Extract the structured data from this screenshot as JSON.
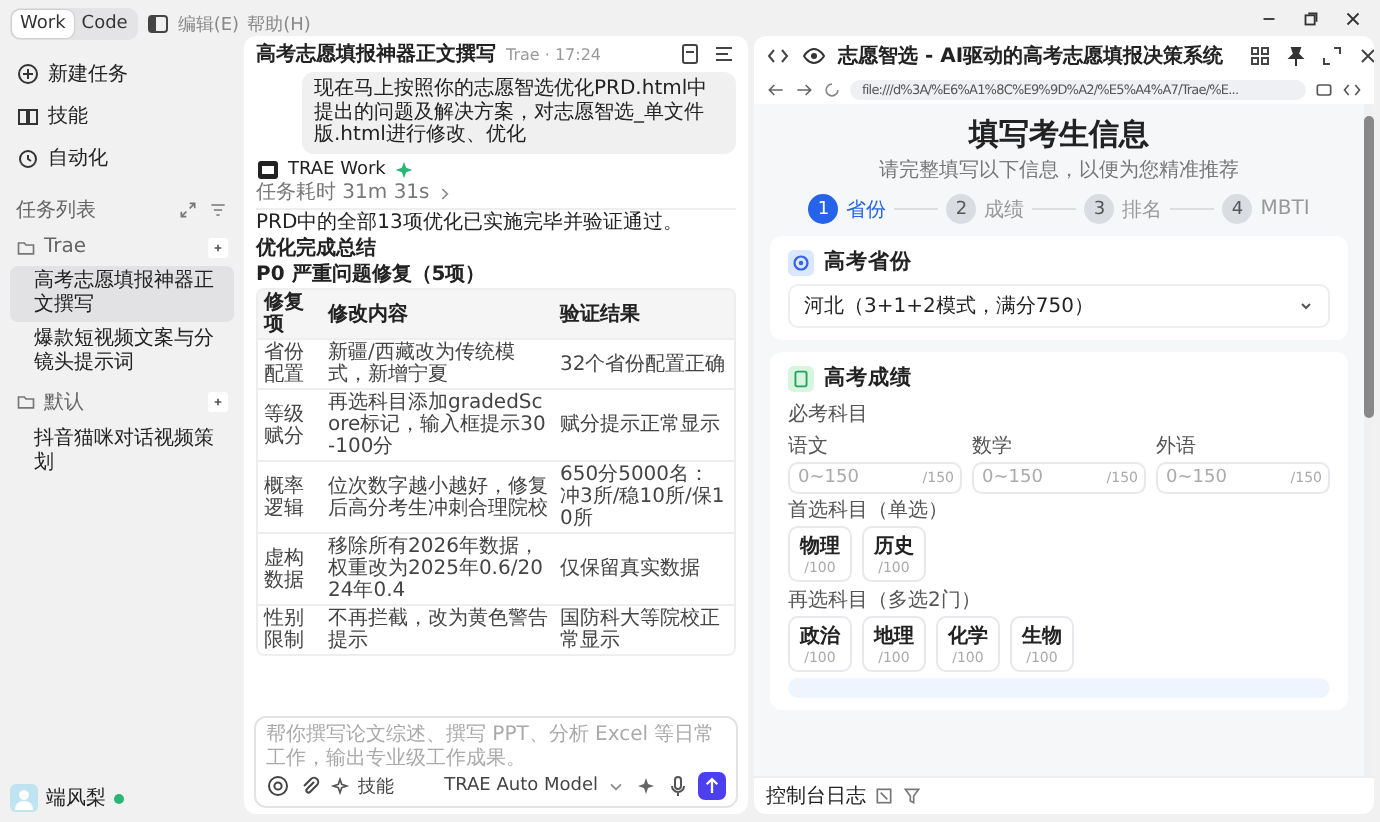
{
  "sidebar": {
    "mode_tabs": [
      {
        "label": "Work",
        "selected": true
      },
      {
        "label": "Code",
        "selected": false
      }
    ],
    "menu": [
      "编辑(E)",
      "帮助(H)"
    ],
    "nav": [
      {
        "label": "新建任务",
        "kind": "new"
      },
      {
        "label": "技能",
        "kind": "skills"
      },
      {
        "label": "自动化",
        "kind": "automation"
      }
    ],
    "task_list_title": "任务列表",
    "groups": [
      {
        "name": "Trae",
        "tasks": [
          {
            "title": "高考志愿填报神器正文撰写",
            "selected": true
          },
          {
            "title": "爆款短视频文案与分镜头提示词",
            "selected": false
          }
        ]
      },
      {
        "name": "默认",
        "tasks": [
          {
            "title": "抖音猫咪对话视频策划",
            "selected": false
          }
        ]
      }
    ],
    "user": {
      "name": "端风梨",
      "online": true
    }
  },
  "chat": {
    "title": "高考志愿填报神器正文撰写",
    "meta": "Trae · 17:24",
    "user_message": "现在马上按照你的志愿智选优化PRD.html中提出的问题及解决方案，对志愿智选_单文件版.html进行修改、优化",
    "agent": "TRAE Work",
    "duration": "任务耗时 31m 31s",
    "summary": "PRD中的全部13项优化已实施完毕并验证通过。",
    "heading": "优化完成总结",
    "subheading": "P0 严重问题修复（5项）",
    "table": {
      "columns": [
        "修复项",
        "修改内容",
        "验证结果"
      ],
      "rows": [
        [
          "省份配置",
          "新疆/西藏改为传统模式，新增宁夏",
          "32个省份配置正确"
        ],
        [
          "等级赋分",
          "再选科目添加gradedScore标记，输入框提示30-100分",
          "赋分提示正常显示"
        ],
        [
          "概率逻辑",
          "位次数字越小越好，修复后高分考生冲刺合理院校",
          "650分5000名：冲3所/稳10所/保10所"
        ],
        [
          "虚构数据",
          "移除所有2026年数据，权重改为2025年0.6/2024年0.4",
          "仅保留真实数据"
        ],
        [
          "性别限制",
          "不再拦截，改为黄色警告提示",
          "国防科大等院校正常显示"
        ]
      ]
    },
    "composer": {
      "placeholder": "帮你撰写论文综述、撰写 PPT、分析 Excel 等日常工作，输出专业级工作成果。",
      "skill_label": "技能",
      "model": "TRAE Auto Model"
    }
  },
  "browser": {
    "title": "志愿智选 - AI驱动的高考志愿填报决策系统",
    "url": "file:///d%3A/%E6%A1%8C%E9%9D%A2/%E5%A4%A7/Trae/%E...",
    "page": {
      "title": "填写考生信息",
      "subtitle": "请完整填写以下信息，以便为您精准推荐",
      "steps": [
        {
          "number": "1",
          "label": "省份",
          "selected": true
        },
        {
          "number": "2",
          "label": "成绩",
          "selected": false
        },
        {
          "number": "3",
          "label": "排名",
          "selected": false
        },
        {
          "number": "4",
          "label": "MBTI",
          "selected": false
        }
      ],
      "province_card": {
        "title": "高考省份",
        "value": "河北（3+1+2模式，满分750）"
      },
      "score_card": {
        "title": "高考成绩",
        "required_label": "必考科目",
        "required": [
          {
            "label": "语文",
            "placeholder": "0~150",
            "max": "/150"
          },
          {
            "label": "数学",
            "placeholder": "0~150",
            "max": "/150"
          },
          {
            "label": "外语",
            "placeholder": "0~150",
            "max": "/150"
          }
        ],
        "first_label": "首选科目（单选）",
        "first": [
          {
            "name": "物理",
            "max": "/100",
            "selected": false
          },
          {
            "name": "历史",
            "max": "/100",
            "selected": false
          }
        ],
        "second_label": "再选科目（多选2门）",
        "second": [
          {
            "name": "政治",
            "max": "/100",
            "selected": false
          },
          {
            "name": "地理",
            "max": "/100",
            "selected": false
          },
          {
            "name": "化学",
            "max": "/100",
            "selected": false
          },
          {
            "name": "生物",
            "max": "/100",
            "selected": false
          }
        ]
      }
    },
    "console": "控制台日志"
  }
}
